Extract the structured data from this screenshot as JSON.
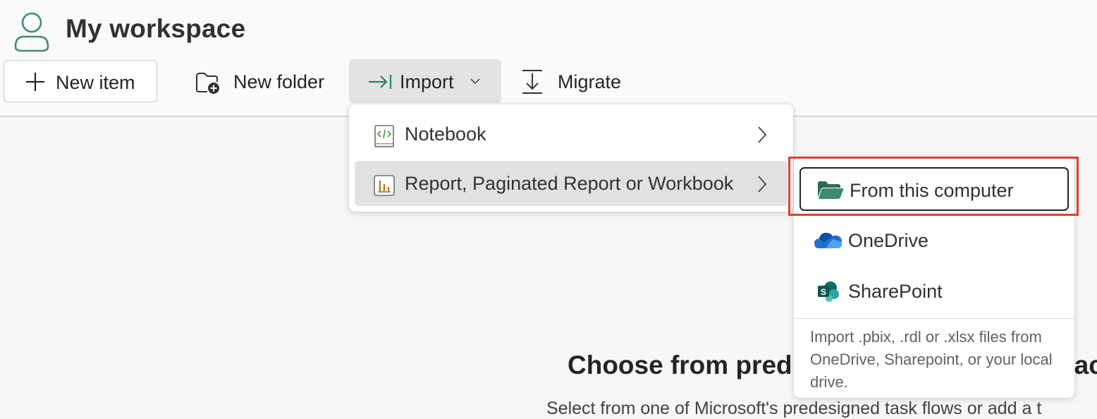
{
  "workspace": {
    "title": "My workspace",
    "icon": "person-icon"
  },
  "toolbar": {
    "new_item_label": "New item",
    "new_folder_label": "New folder",
    "import_label": "Import",
    "migrate_label": "Migrate"
  },
  "import_menu": {
    "items": [
      {
        "label": "Notebook",
        "icon": "notebook-icon",
        "has_submenu": true
      },
      {
        "label": "Report, Paginated Report or Workbook",
        "icon": "report-icon",
        "has_submenu": true
      }
    ]
  },
  "import_submenu": {
    "items": [
      {
        "label": "From this computer",
        "icon": "folder-open-icon"
      },
      {
        "label": "OneDrive",
        "icon": "onedrive-icon"
      },
      {
        "label": "SharePoint",
        "icon": "sharepoint-icon"
      }
    ],
    "note": "Import .pbix, .rdl or .xlsx files from OneDrive, Sharepoint, or your local drive."
  },
  "main": {
    "heading_visible": "Choose from pred",
    "heading_tail": "ac",
    "description": "Select from one of Microsoft's predesigned task flows or add a t"
  },
  "colors": {
    "brand_green": "#2f7d6a",
    "highlight_red": "#e0412c",
    "menu_hover": "#e1e1e1"
  }
}
